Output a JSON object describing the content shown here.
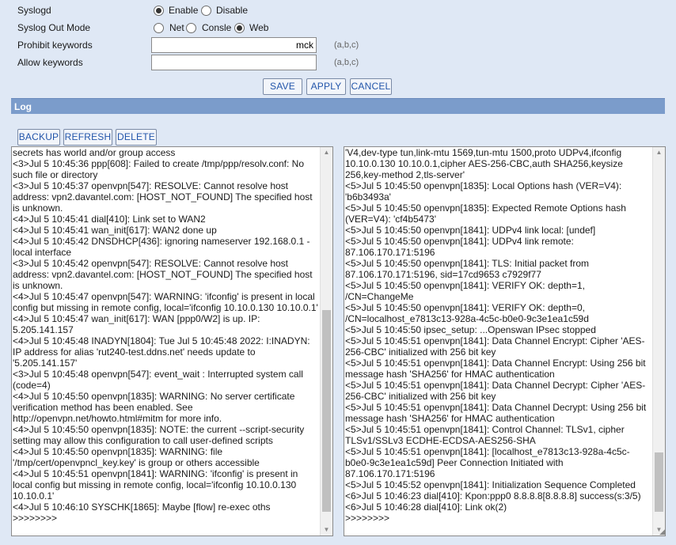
{
  "settings": {
    "syslogd": {
      "label": "Syslogd",
      "options": [
        "Enable",
        "Disable"
      ],
      "selected": "Enable"
    },
    "out_mode": {
      "label": "Syslog Out Mode",
      "options": [
        "Net",
        "Consle",
        "Web"
      ],
      "selected": "Web"
    },
    "prohibit": {
      "label": "Prohibit keywords",
      "value": "mck",
      "hint": "(a,b,c)"
    },
    "allow": {
      "label": "Allow keywords",
      "value": "",
      "hint": "(a,b,c)"
    }
  },
  "actions": {
    "save": "SAVE",
    "apply": "APPLY",
    "cancel": "CANCEL"
  },
  "log": {
    "title": "Log",
    "buttons": {
      "backup": "BACKUP",
      "refresh": "REFRESH",
      "delete": "DELETE"
    },
    "left_lines": [
      "secrets has world and/or group access",
      "<3>Jul  5 10:45:36 ppp[608]: Failed to create /tmp/ppp/resolv.conf: No such file or directory",
      "<3>Jul  5 10:45:37 openvpn[547]: RESOLVE: Cannot resolve host address: vpn2.davantel.com: [HOST_NOT_FOUND] The specified host is unknown.",
      "<4>Jul  5 10:45:41 dial[410]: Link set to WAN2",
      "<4>Jul  5 10:45:41 wan_init[617]: WAN2 done up",
      "<4>Jul  5 10:45:42 DNSDHCP[436]: ignoring nameserver 192.168.0.1 - local interface",
      "<3>Jul  5 10:45:42 openvpn[547]: RESOLVE: Cannot resolve host address: vpn2.davantel.com: [HOST_NOT_FOUND] The specified host is unknown.",
      "<4>Jul  5 10:45:47 openvpn[547]: WARNING: 'ifconfig' is present in local config but missing in remote config, local='ifconfig 10.10.0.130 10.10.0.1'",
      "<4>Jul  5 10:45:47 wan_init[617]: WAN [ppp0/W2] is up. IP: 5.205.141.157",
      "<4>Jul  5 10:45:48 INADYN[1804]: Tue Jul  5 10:45:48 2022: I:INADYN: IP address for alias 'rut240-test.ddns.net' needs update to '5.205.141.157'",
      "<3>Jul  5 10:45:48 openvpn[547]: event_wait : Interrupted system call (code=4)",
      "<4>Jul  5 10:45:50 openvpn[1835]: WARNING: No server certificate verification method has been enabled.  See http://openvpn.net/howto.html#mitm for more info.",
      "<4>Jul  5 10:45:50 openvpn[1835]: NOTE: the current --script-security setting may allow this configuration to call user-defined scripts",
      "<4>Jul  5 10:45:50 openvpn[1835]: WARNING: file '/tmp/cert/openvpncl_key.key' is group or others accessible",
      "<4>Jul  5 10:45:51 openvpn[1841]: WARNING: 'ifconfig' is present in local config but missing in remote config, local='ifconfig 10.10.0.130 10.10.0.1'",
      "<4>Jul  5 10:46:10 SYSCHK[1865]: Maybe [flow] re-exec oths",
      ">>>>>>>>"
    ],
    "right_lines": [
      "'V4,dev-type tun,link-mtu 1569,tun-mtu 1500,proto UDPv4,ifconfig 10.10.0.130 10.10.0.1,cipher AES-256-CBC,auth SHA256,keysize 256,key-method 2,tls-server'",
      "<5>Jul  5 10:45:50 openvpn[1835]: Local Options hash (VER=V4): 'b6b3493a'",
      "<5>Jul  5 10:45:50 openvpn[1835]: Expected Remote Options hash (VER=V4): 'cf4b5473'",
      "<5>Jul  5 10:45:50 openvpn[1841]: UDPv4 link local: [undef]",
      "<5>Jul  5 10:45:50 openvpn[1841]: UDPv4 link remote: 87.106.170.171:5196",
      "<5>Jul  5 10:45:50 openvpn[1841]: TLS: Initial packet from 87.106.170.171:5196, sid=17cd9653 c7929f77",
      "<5>Jul  5 10:45:50 openvpn[1841]: VERIFY OK: depth=1, /CN=ChangeMe",
      "<5>Jul  5 10:45:50 openvpn[1841]: VERIFY OK: depth=0, /CN=localhost_e7813c13-928a-4c5c-b0e0-9c3e1ea1c59d",
      "<5>Jul  5 10:45:50 ipsec_setup: ...Openswan IPsec stopped",
      "<5>Jul  5 10:45:51 openvpn[1841]: Data Channel Encrypt: Cipher 'AES-256-CBC' initialized with 256 bit key",
      "<5>Jul  5 10:45:51 openvpn[1841]: Data Channel Encrypt: Using 256 bit message hash 'SHA256' for HMAC authentication",
      "<5>Jul  5 10:45:51 openvpn[1841]: Data Channel Decrypt: Cipher 'AES-256-CBC' initialized with 256 bit key",
      "<5>Jul  5 10:45:51 openvpn[1841]: Data Channel Decrypt: Using 256 bit message hash 'SHA256' for HMAC authentication",
      "<5>Jul  5 10:45:51 openvpn[1841]: Control Channel: TLSv1, cipher TLSv1/SSLv3 ECDHE-ECDSA-AES256-SHA",
      "<5>Jul  5 10:45:51 openvpn[1841]: [localhost_e7813c13-928a-4c5c-b0e0-9c3e1ea1c59d] Peer Connection Initiated with 87.106.170.171:5196",
      "<5>Jul  5 10:45:52 openvpn[1841]: Initialization Sequence Completed",
      "<6>Jul  5 10:46:23 dial[410]: Kpon:ppp0 8.8.8.8[8.8.8.8] success(s:3/5)",
      "<6>Jul  5 10:46:28 dial[410]: Link ok(2)",
      ">>>>>>>>"
    ]
  }
}
